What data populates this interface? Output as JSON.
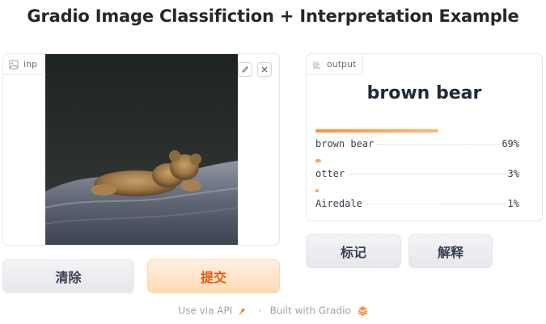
{
  "page": {
    "title": "Gradio Image Classifiction + Interpretation Example"
  },
  "input_panel": {
    "label": "inp",
    "image_description": "brown teddy bear lying on a grey blanket",
    "edit_icon": "pencil-icon",
    "clear_icon": "close-icon"
  },
  "buttons": {
    "clear": "清除",
    "submit": "提交",
    "flag": "标记",
    "interpret": "解释"
  },
  "output_panel": {
    "label": "output",
    "top_label": "brown bear",
    "confidences": [
      {
        "label": "brown bear",
        "percent": "69%",
        "value": 0.69
      },
      {
        "label": "otter",
        "percent": "3%",
        "value": 0.03
      },
      {
        "label": "Airedale",
        "percent": "1%",
        "value": 0.01
      }
    ]
  },
  "footer": {
    "api_text": "Use via API",
    "separator": "·",
    "built_text": "Built with Gradio"
  },
  "colors": {
    "accent": "#f97316",
    "primary_button_text": "#ea580c"
  }
}
